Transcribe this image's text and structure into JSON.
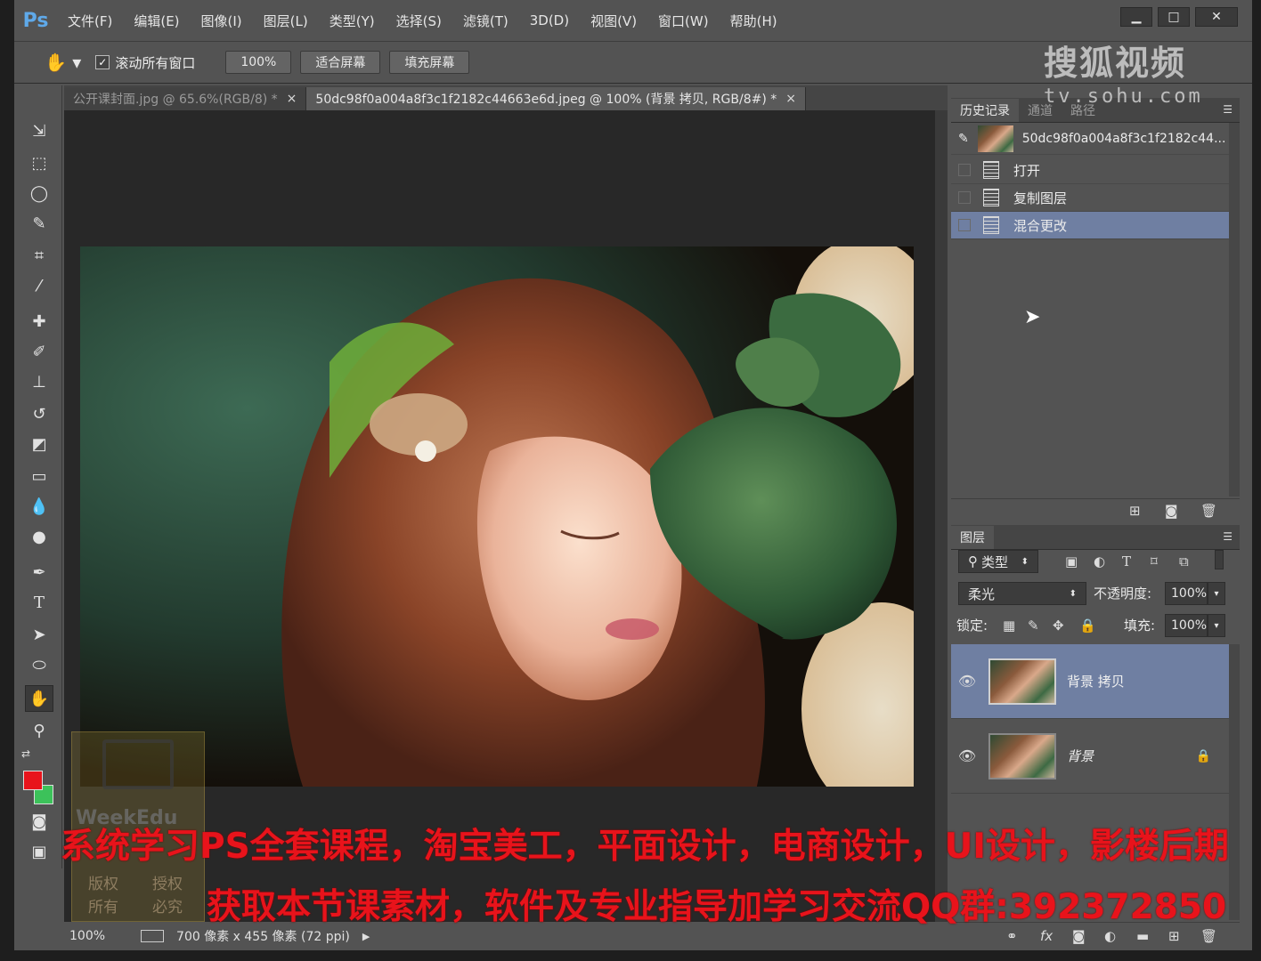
{
  "app": {
    "logo": "Ps"
  },
  "menu": [
    "文件(F)",
    "编辑(E)",
    "图像(I)",
    "图层(L)",
    "类型(Y)",
    "选择(S)",
    "滤镜(T)",
    "3D(D)",
    "视图(V)",
    "窗口(W)",
    "帮助(H)"
  ],
  "window_controls": {
    "minimize": "▁",
    "maximize": "□",
    "close": "✕"
  },
  "options": {
    "scroll_all_label": "滚动所有窗口",
    "zoom_100": "100%",
    "fit_screen": "适合屏幕",
    "fill_screen": "填充屏幕"
  },
  "doc_tabs": [
    {
      "label": "公开课封面.jpg @ 65.6%(RGB/8) *",
      "close": "×"
    },
    {
      "label": "50dc98f0a004a8f3c1f2182c44663e6d.jpeg @ 100% (背景 拷贝, RGB/8#) *",
      "close": "×"
    }
  ],
  "status": {
    "zoom": "100%",
    "doc_info": "700 像素 x 455 像素 (72 ppi)",
    "arrow": "▶"
  },
  "history_panel": {
    "tabs": [
      "历史记录",
      "通道",
      "路径"
    ],
    "snapshot_name": "50dc98f0a004a8f3c1f2182c44...",
    "steps": [
      "打开",
      "复制图层",
      "混合更改"
    ],
    "selected_step": "混合更改"
  },
  "layers_panel": {
    "tab": "图层",
    "filter_kind": "类型",
    "blend_mode": "柔光",
    "opacity_label": "不透明度:",
    "opacity_value": "100%",
    "lock_label": "锁定:",
    "fill_label": "填充:",
    "fill_value": "100%",
    "layers": [
      {
        "name": "背景 拷贝",
        "selected": true
      },
      {
        "name": "背景",
        "selected": false,
        "locked": true
      }
    ]
  },
  "watermark": {
    "logo": "搜狐视频",
    "url": "tv.sohu.com",
    "weekedu": "WeekEdu",
    "weekedu_sub": [
      "版权",
      "授权",
      "所有",
      "必究"
    ]
  },
  "banner": {
    "line1": "系统学习PS全套课程，淘宝美工，平面设计，电商设计，UI设计，影楼后期",
    "line2": "获取本节课素材，软件及专业指导加学习交流QQ群:392372850"
  },
  "colors": {
    "foreground": "#e8141c",
    "background": "#3cc25a",
    "selection": "#6f7fa2",
    "ui_dark": "#535353"
  }
}
